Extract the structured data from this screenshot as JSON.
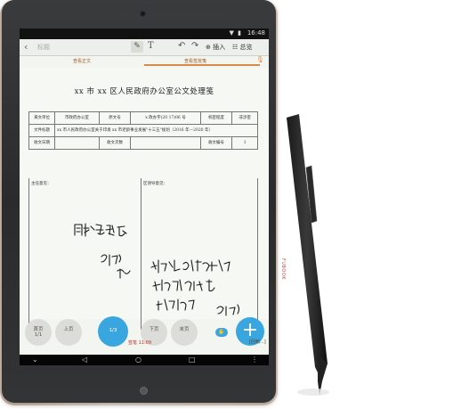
{
  "status_bar": {
    "time": "16:48",
    "icons": "▼ ▮"
  },
  "toolbar": {
    "back_label": "‹",
    "title_placeholder": "标题",
    "pen_label": "✎",
    "text_label": "T",
    "undo_label": "↶",
    "redo_label": "↷",
    "insert_label": "⊕ 插入",
    "overview_label": "☷ 总览"
  },
  "tabs": {
    "left": "查看正文",
    "right": "查看签批笺",
    "accent_color": "#d88a4a"
  },
  "document": {
    "title": "xx 市 xx 区人民政府办公室公文处理笺",
    "table": {
      "row1": [
        "来文单位",
        "市政府办公室",
        "原文号",
        "x 政办字(20 17)06 号",
        "机密程度",
        "非涉密"
      ],
      "row2_label": "文件标题",
      "row2_value": "xx 市人民政府办公室关于印发 xx 市老龄事业发展\"十三五\"规划（2016 年—2020 年）",
      "row3": [
        "收文日期",
        "",
        "收文次数",
        "",
        "收文编号",
        "1"
      ]
    },
    "host_opinion_label": "主任意见：",
    "leader_opinion_label": "区领导意见："
  },
  "bottom": {
    "first_label": "首页",
    "first_sub": "1/1",
    "prev_label": "上页",
    "page_label": "1/3",
    "next_label": "下页",
    "last_label": "末页",
    "sign_time": "签笔 11:09",
    "add_label": "+",
    "save_label": "[回到...]",
    "accent_color": "#3aa6df"
  },
  "navbar": {
    "icons": [
      "⌄",
      "◁",
      "○",
      "□",
      "⋮"
    ]
  },
  "brand_side": "FUBOOK"
}
